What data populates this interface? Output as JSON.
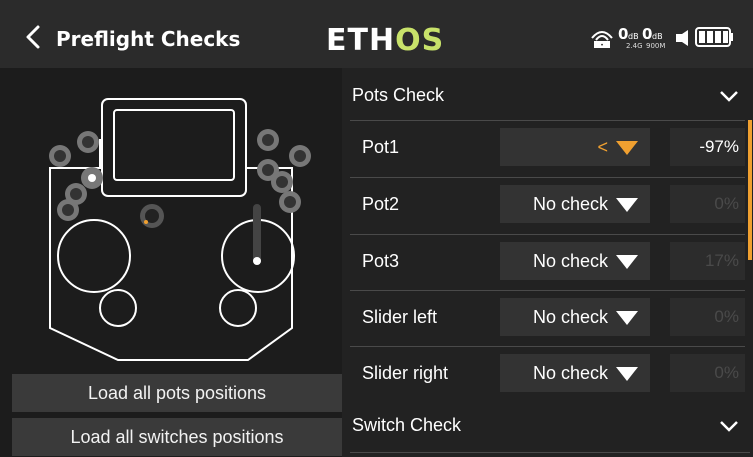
{
  "header": {
    "title": "Preflight Checks",
    "logo_left": "ETH",
    "logo_right": "OS",
    "rssi1": "0",
    "rssi1_unit": "dB",
    "rssi2": "0",
    "rssi2_unit": "dB",
    "band1": "2.4G",
    "band2": "900M"
  },
  "left": {
    "load_pots_label": "Load all pots positions",
    "load_switches_label": "Load all switches positions"
  },
  "right": {
    "pots_section": "Pots Check",
    "switch_section": "Switch Check",
    "rows": [
      {
        "name": "Pot1",
        "mode": "<",
        "value": "-97%"
      },
      {
        "name": "Pot2",
        "mode": "No check",
        "value": "0%"
      },
      {
        "name": "Pot3",
        "mode": "No check",
        "value": "17%"
      },
      {
        "name": "Slider left",
        "mode": "No check",
        "value": "0%"
      },
      {
        "name": "Slider right",
        "mode": "No check",
        "value": "0%"
      }
    ]
  },
  "colors": {
    "accent": "#f0a030",
    "logo_green": "#c8e26a",
    "background": "#1f1f1f"
  }
}
